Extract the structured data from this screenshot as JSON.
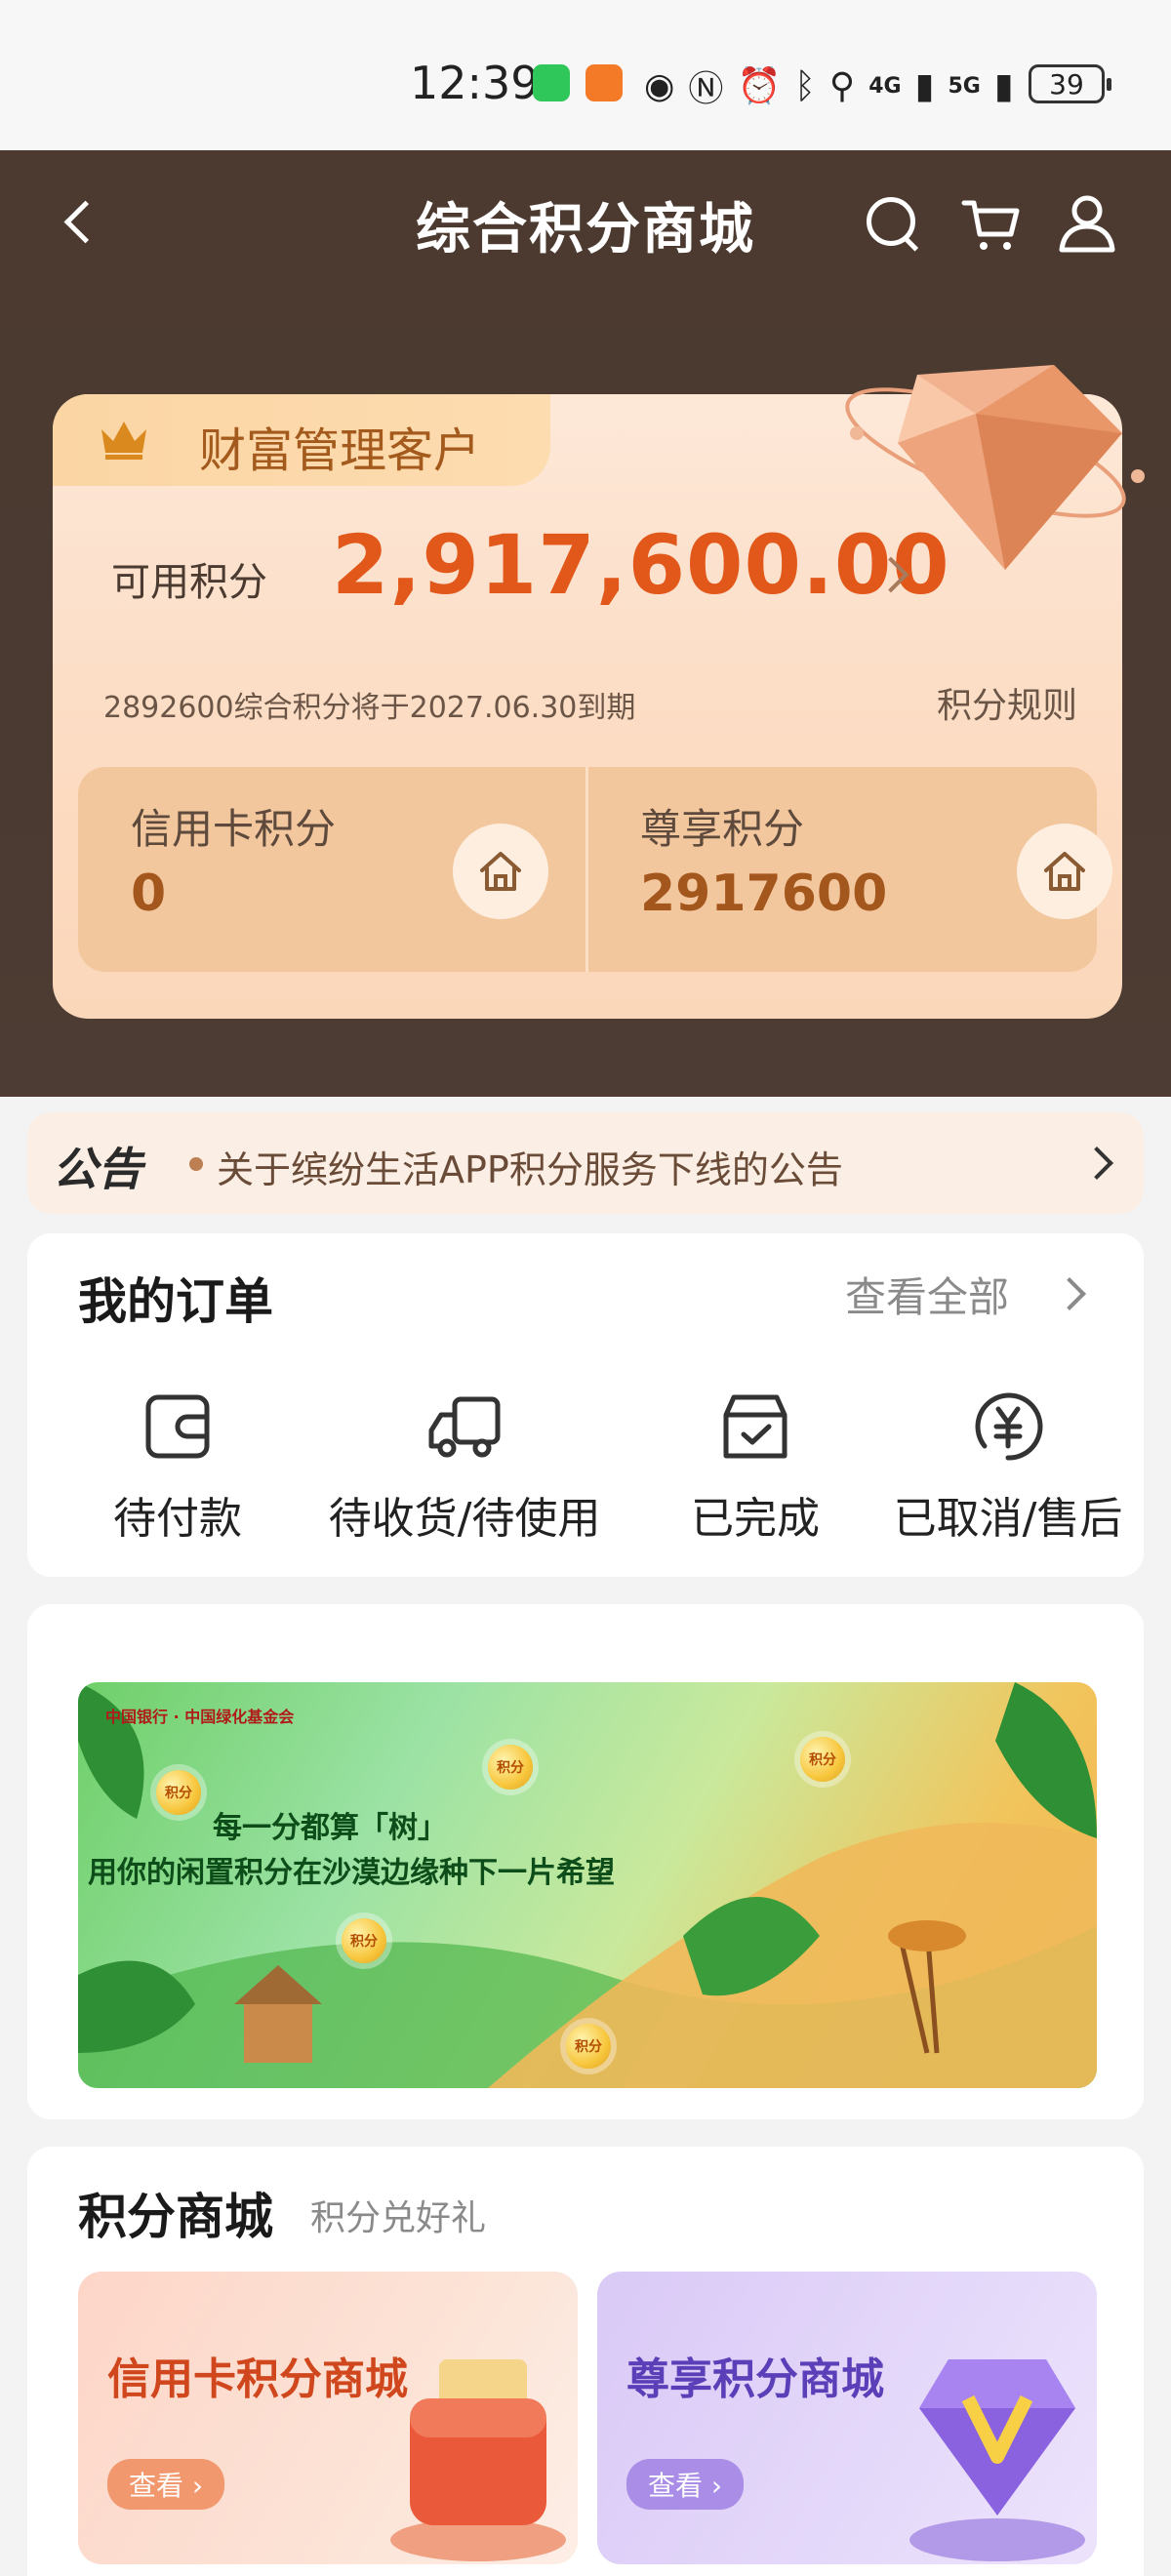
{
  "status_bar": {
    "time": "12:39",
    "network_4g": "4G",
    "network_5g": "5G",
    "battery": "39"
  },
  "header": {
    "title": "综合积分商城"
  },
  "points_card": {
    "customer_tier": "财富管理客户",
    "available_label": "可用积分",
    "available_value": "2,917,600.00",
    "expiry_note": "2892600综合积分将于2027.06.30到期",
    "rules_link": "积分规则",
    "credit_label": "信用卡积分",
    "credit_value": "0",
    "vip_label": "尊享积分",
    "vip_value": "2917600"
  },
  "notice": {
    "tag": "公告",
    "text": "关于缤纷生活APP积分服务下线的公告"
  },
  "orders": {
    "title": "我的订单",
    "view_all": "查看全部",
    "items": [
      {
        "label": "待付款",
        "icon": "wallet-icon"
      },
      {
        "label": "待收货/待使用",
        "icon": "truck-icon"
      },
      {
        "label": "已完成",
        "icon": "box-check-icon"
      },
      {
        "label": "已取消/售后",
        "icon": "yen-refund-icon"
      }
    ]
  },
  "banner": {
    "line1": "每一分都算「树」",
    "line2": "用你的闲置积分在沙漠边缘种下一片希望",
    "coin_label": "积分"
  },
  "mall": {
    "title": "积分商城",
    "subtitle": "积分兑好礼",
    "cards": [
      {
        "label": "信用卡积分商城",
        "button": "查看"
      },
      {
        "label": "尊享积分商城",
        "button": "查看"
      }
    ]
  },
  "colors": {
    "hero_bg": "#4b3a31",
    "points_accent": "#e2581b",
    "card_bg": "#fcdcc3"
  }
}
